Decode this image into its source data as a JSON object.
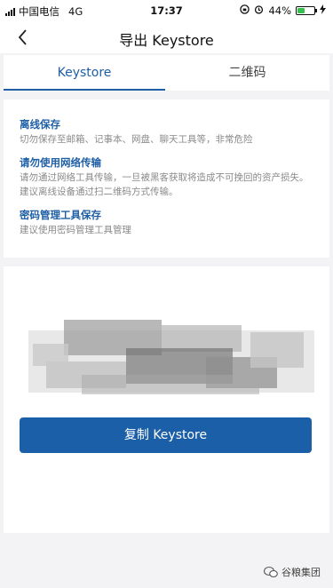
{
  "status_bar": {
    "carrier": "中国电信",
    "network": "4G",
    "time": "17:37",
    "battery": "44%",
    "battery_level": 0.44
  },
  "nav": {
    "title": "导出 Keystore"
  },
  "tabs": [
    {
      "label": "Keystore",
      "active": true
    },
    {
      "label": "二维码",
      "active": false
    }
  ],
  "tips": [
    {
      "title": "离线保存",
      "body": "切勿保存至邮箱、记事本、网盘、聊天工具等，非常危险"
    },
    {
      "title": "请勿使用网络传输",
      "body": "请勿通过网络工具传输，一旦被黑客获取将造成不可挽回的资产损失。建议离线设备通过扫二维码方式传输。"
    },
    {
      "title": "密码管理工具保存",
      "body": "建议使用密码管理工具管理"
    }
  ],
  "actions": {
    "copy_label": "复制 Keystore"
  },
  "watermark": "谷粮集团",
  "colors": {
    "accent": "#1f5fa6",
    "button": "#1b5fa8",
    "tip_text": "#8a8a8a"
  }
}
